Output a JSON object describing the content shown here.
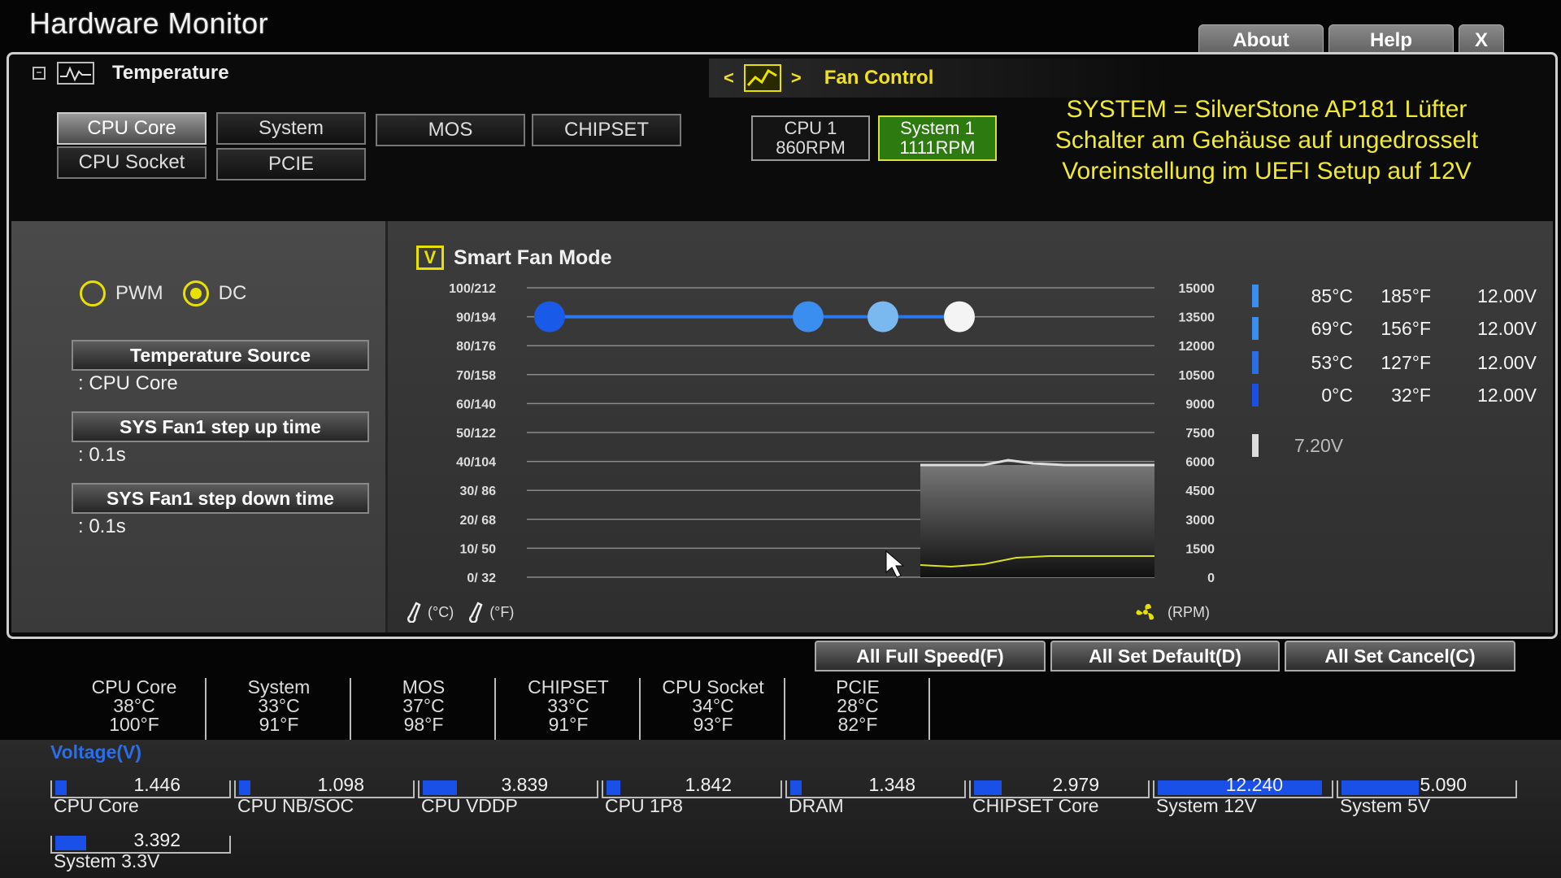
{
  "app": {
    "title": "Hardware Monitor",
    "about": "About",
    "help": "Help",
    "close": "X"
  },
  "temperature_section": {
    "label": "Temperature",
    "sources": [
      {
        "label": "CPU Core",
        "active": true
      },
      {
        "label": "System",
        "active": false
      },
      {
        "label": "MOS",
        "active": false
      },
      {
        "label": "CHIPSET",
        "active": false
      },
      {
        "label": "CPU Socket",
        "active": false
      },
      {
        "label": "PCIE",
        "active": false
      }
    ]
  },
  "fan_control": {
    "label": "Fan Control",
    "prev_arrow": "<",
    "next_arrow": ">",
    "fans": [
      {
        "name": "CPU 1",
        "rpm": "860RPM",
        "active": false
      },
      {
        "name": "System 1",
        "rpm": "1111RPM",
        "active": true
      }
    ]
  },
  "note": {
    "line1": "SYSTEM = SilverStone AP181 Lüfter",
    "line2": "Schalter am Gehäuse auf ungedrosselt",
    "line3": "Voreinstellung im UEFI Setup auf 12V"
  },
  "settings": {
    "pwm_label": "PWM",
    "dc_label": "DC",
    "mode": "DC",
    "temp_source_label": "Temperature Source",
    "temp_source_value": ": CPU Core",
    "step_up_label": "SYS Fan1 step up time",
    "step_up_value": ": 0.1s",
    "step_down_label": "SYS Fan1 step down time",
    "step_down_value": ": 0.1s"
  },
  "smart_fan": {
    "checkbox": "V",
    "label": "Smart Fan Mode",
    "unit_c": "(°C)",
    "unit_f": "(°F)",
    "unit_rpm": "(RPM)"
  },
  "chart_data": {
    "type": "line",
    "left_ticks": [
      "100/212",
      "90/194",
      "80/176",
      "70/158",
      "60/140",
      "50/122",
      "40/104",
      "30/  86",
      "20/  68",
      "10/  50",
      "0/  32"
    ],
    "right_ticks": [
      "15000",
      "13500",
      "12000",
      "10500",
      "9000",
      "7500",
      "6000",
      "4500",
      "3000",
      "1500",
      "0"
    ],
    "ylim_percent": [
      0,
      100
    ],
    "fan_curve_points_percent": [
      90,
      90,
      90,
      90
    ],
    "grid": true
  },
  "fan_points": [
    {
      "c": "85°C",
      "f": "185°F",
      "v": "12.00V",
      "color": "#3a8ef0"
    },
    {
      "c": "69°C",
      "f": "156°F",
      "v": "12.00V",
      "color": "#3a8ef0"
    },
    {
      "c": "53°C",
      "f": "127°F",
      "v": "12.00V",
      "color": "#2a6ee8"
    },
    {
      "c": "0°C",
      "f": "32°F",
      "v": "12.00V",
      "color": "#1a4fe8"
    }
  ],
  "min_voltage": "7.20V",
  "actions": {
    "full_speed": "All Full Speed(F)",
    "set_default": "All Set Default(D)",
    "set_cancel": "All Set Cancel(C)"
  },
  "temps": [
    {
      "name": "CPU Core",
      "c": "38°C",
      "f": "100°F"
    },
    {
      "name": "System",
      "c": "33°C",
      "f": "91°F"
    },
    {
      "name": "MOS",
      "c": "37°C",
      "f": "98°F"
    },
    {
      "name": "CHIPSET",
      "c": "33°C",
      "f": "91°F"
    },
    {
      "name": "CPU Socket",
      "c": "34°C",
      "f": "93°F"
    },
    {
      "name": "PCIE",
      "c": "28°C",
      "f": "82°F"
    }
  ],
  "voltage": {
    "label": "Voltage(V)",
    "items": [
      {
        "name": "CPU Core",
        "value": "1.446",
        "fill": 0.06
      },
      {
        "name": "CPU NB/SOC",
        "value": "1.098",
        "fill": 0.05
      },
      {
        "name": "CPU VDDP",
        "value": "3.839",
        "fill": 0.2
      },
      {
        "name": "CPU 1P8",
        "value": "1.842",
        "fill": 0.08
      },
      {
        "name": "DRAM",
        "value": "1.348",
        "fill": 0.06
      },
      {
        "name": "CHIPSET Core",
        "value": "2.979",
        "fill": 0.16
      },
      {
        "name": "System 12V",
        "value": "12.240",
        "fill": 0.96
      },
      {
        "name": "System 5V",
        "value": "5.090",
        "fill": 0.45
      },
      {
        "name": "System 3.3V",
        "value": "3.392",
        "fill": 0.18
      }
    ]
  },
  "colors": {
    "accent_yellow": "#e8e000",
    "note_yellow": "#f0ea30",
    "bar_blue": "#1a4fe8",
    "active_green": "#2d7a10"
  }
}
